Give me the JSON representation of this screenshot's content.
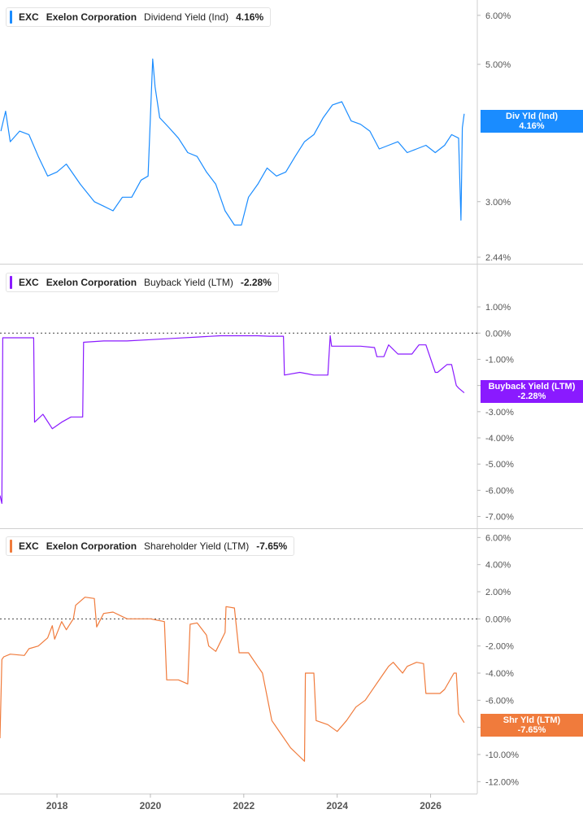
{
  "chart_data": [
    {
      "type": "line",
      "ticker": "EXC",
      "company": "Exelon Corporation",
      "metric": "Dividend Yield (Ind)",
      "current_value": "4.16%",
      "tag_label": "Div Yld (Ind)",
      "tag_value": "4.16%",
      "color": "#1a8cff",
      "ylim": [
        2.44,
        6.2
      ],
      "log_scale": true,
      "y_ticks": [
        "6.00%",
        "5.00%",
        "3.00%",
        "2.44%"
      ],
      "y_tick_values": [
        6,
        5,
        3,
        2.44
      ],
      "series": [
        {
          "x": [
            2016.8,
            2016.9,
            2017.0,
            2017.2,
            2017.4,
            2017.6,
            2017.8,
            2018.0,
            2018.2,
            2018.5,
            2018.8,
            2019.0,
            2019.2,
            2019.4,
            2019.6,
            2019.8,
            2019.95,
            2020.05,
            2020.1,
            2020.2,
            2020.4,
            2020.6,
            2020.8,
            2021.0,
            2021.2,
            2021.4,
            2021.6,
            2021.8,
            2021.95,
            2022.1,
            2022.3,
            2022.5,
            2022.7,
            2022.9,
            2023.1,
            2023.3,
            2023.5,
            2023.7,
            2023.9,
            2024.1,
            2024.3,
            2024.5,
            2024.7,
            2024.9,
            2025.1,
            2025.3,
            2025.5,
            2025.7,
            2025.9,
            2026.1,
            2026.3,
            2026.45,
            2026.6,
            2026.65,
            2026.68,
            2026.72
          ],
          "values": [
            3.9,
            4.2,
            3.75,
            3.9,
            3.85,
            3.55,
            3.3,
            3.35,
            3.45,
            3.2,
            3.0,
            2.95,
            2.9,
            3.05,
            3.05,
            3.25,
            3.3,
            5.1,
            4.6,
            4.1,
            3.95,
            3.8,
            3.6,
            3.55,
            3.35,
            3.2,
            2.9,
            2.75,
            2.75,
            3.05,
            3.2,
            3.4,
            3.3,
            3.35,
            3.55,
            3.75,
            3.85,
            4.1,
            4.3,
            4.35,
            4.05,
            4.0,
            3.9,
            3.65,
            3.7,
            3.75,
            3.6,
            3.65,
            3.7,
            3.6,
            3.7,
            3.85,
            3.8,
            2.8,
            3.95,
            4.16
          ]
        }
      ]
    },
    {
      "type": "line",
      "ticker": "EXC",
      "company": "Exelon Corporation",
      "metric": "Buyback Yield (LTM)",
      "current_value": "-2.28%",
      "tag_label": "Buyback Yield (LTM)",
      "tag_value": "-2.28%",
      "color": "#8a1aff",
      "ylim": [
        -7.2,
        2.4
      ],
      "y_ticks": [
        "1.00%",
        "0.00%",
        "-1.00%",
        "-2.00%",
        "-3.00%",
        "-4.00%",
        "-5.00%",
        "-6.00%",
        "-7.00%"
      ],
      "y_tick_values": [
        1,
        0,
        -1,
        -2,
        -3,
        -4,
        -5,
        -6,
        -7
      ],
      "series": [
        {
          "x": [
            2016.78,
            2016.82,
            2016.84,
            2017.5,
            2017.52,
            2017.7,
            2017.9,
            2018.1,
            2018.3,
            2018.55,
            2018.57,
            2019.0,
            2019.5,
            2020.0,
            2020.5,
            2021.0,
            2021.5,
            2022.0,
            2022.3,
            2022.55,
            2022.85,
            2022.87,
            2023.2,
            2023.5,
            2023.8,
            2023.85,
            2023.88,
            2024.2,
            2024.5,
            2024.8,
            2024.85,
            2025.0,
            2025.1,
            2025.3,
            2025.6,
            2025.75,
            2025.9,
            2026.1,
            2026.15,
            2026.35,
            2026.45,
            2026.55,
            2026.6,
            2026.72
          ],
          "values": [
            -6.2,
            -6.5,
            -0.18,
            -0.18,
            -3.4,
            -3.1,
            -3.65,
            -3.4,
            -3.2,
            -3.2,
            -0.35,
            -0.3,
            -0.3,
            -0.25,
            -0.2,
            -0.15,
            -0.1,
            -0.1,
            -0.1,
            -0.12,
            -0.12,
            -1.6,
            -1.5,
            -1.6,
            -1.6,
            -0.1,
            -0.5,
            -0.5,
            -0.5,
            -0.55,
            -0.9,
            -0.9,
            -0.45,
            -0.8,
            -0.8,
            -0.45,
            -0.45,
            -1.5,
            -1.5,
            -1.2,
            -1.2,
            -2.0,
            -2.1,
            -2.28
          ]
        }
      ]
    },
    {
      "type": "line",
      "ticker": "EXC",
      "company": "Exelon Corporation",
      "metric": "Shareholder Yield (LTM)",
      "current_value": "-7.65%",
      "tag_label": "Shr Yld (LTM)",
      "tag_value": "-7.65%",
      "color": "#f07b3c",
      "ylim": [
        -12.4,
        6.2
      ],
      "y_ticks": [
        "6.00%",
        "4.00%",
        "2.00%",
        "0.00%",
        "-2.00%",
        "-4.00%",
        "-6.00%",
        "-8.00%",
        "-10.00%",
        "-12.00%"
      ],
      "y_tick_values": [
        6,
        4,
        2,
        0,
        -2,
        -4,
        -6,
        -8,
        -10,
        -12
      ],
      "x_ticks": [
        "2018",
        "2020",
        "2022",
        "2024",
        "2026"
      ],
      "x_tick_values": [
        2018,
        2020,
        2022,
        2024,
        2026
      ],
      "xlim": [
        2016.78,
        2027.0
      ],
      "series": [
        {
          "x": [
            2016.78,
            2016.82,
            2016.86,
            2017.0,
            2017.3,
            2017.4,
            2017.6,
            2017.8,
            2017.9,
            2017.95,
            2018.1,
            2018.2,
            2018.35,
            2018.4,
            2018.6,
            2018.8,
            2018.85,
            2019.0,
            2019.2,
            2019.5,
            2019.8,
            2020.0,
            2020.3,
            2020.35,
            2020.6,
            2020.8,
            2020.85,
            2021.0,
            2021.2,
            2021.25,
            2021.4,
            2021.6,
            2021.62,
            2021.8,
            2021.9,
            2022.1,
            2022.3,
            2022.4,
            2022.6,
            2022.8,
            2023.0,
            2023.15,
            2023.3,
            2023.32,
            2023.5,
            2023.55,
            2023.8,
            2024.0,
            2024.2,
            2024.4,
            2024.6,
            2024.8,
            2025.0,
            2025.1,
            2025.2,
            2025.4,
            2025.5,
            2025.7,
            2025.85,
            2025.9,
            2026.2,
            2026.3,
            2026.5,
            2026.55,
            2026.6,
            2026.72
          ],
          "values": [
            -8.8,
            -3.0,
            -2.8,
            -2.6,
            -2.7,
            -2.2,
            -2.0,
            -1.4,
            -0.5,
            -1.5,
            -0.2,
            -0.8,
            0.0,
            1.0,
            1.6,
            1.5,
            -0.6,
            0.4,
            0.5,
            0.0,
            0.0,
            0.0,
            -0.2,
            -4.5,
            -4.5,
            -4.8,
            -0.4,
            -0.3,
            -1.2,
            -2.0,
            -2.4,
            -1.0,
            0.9,
            0.8,
            -2.5,
            -2.5,
            -3.5,
            -4.0,
            -7.5,
            -8.5,
            -9.5,
            -10.0,
            -10.5,
            -4.0,
            -4.0,
            -7.5,
            -7.8,
            -8.3,
            -7.5,
            -6.5,
            -6.0,
            -5.0,
            -4.0,
            -3.5,
            -3.2,
            -4.0,
            -3.5,
            -3.2,
            -3.3,
            -5.5,
            -5.5,
            -5.2,
            -4.0,
            -4.0,
            -7.0,
            -7.65
          ]
        }
      ]
    }
  ]
}
